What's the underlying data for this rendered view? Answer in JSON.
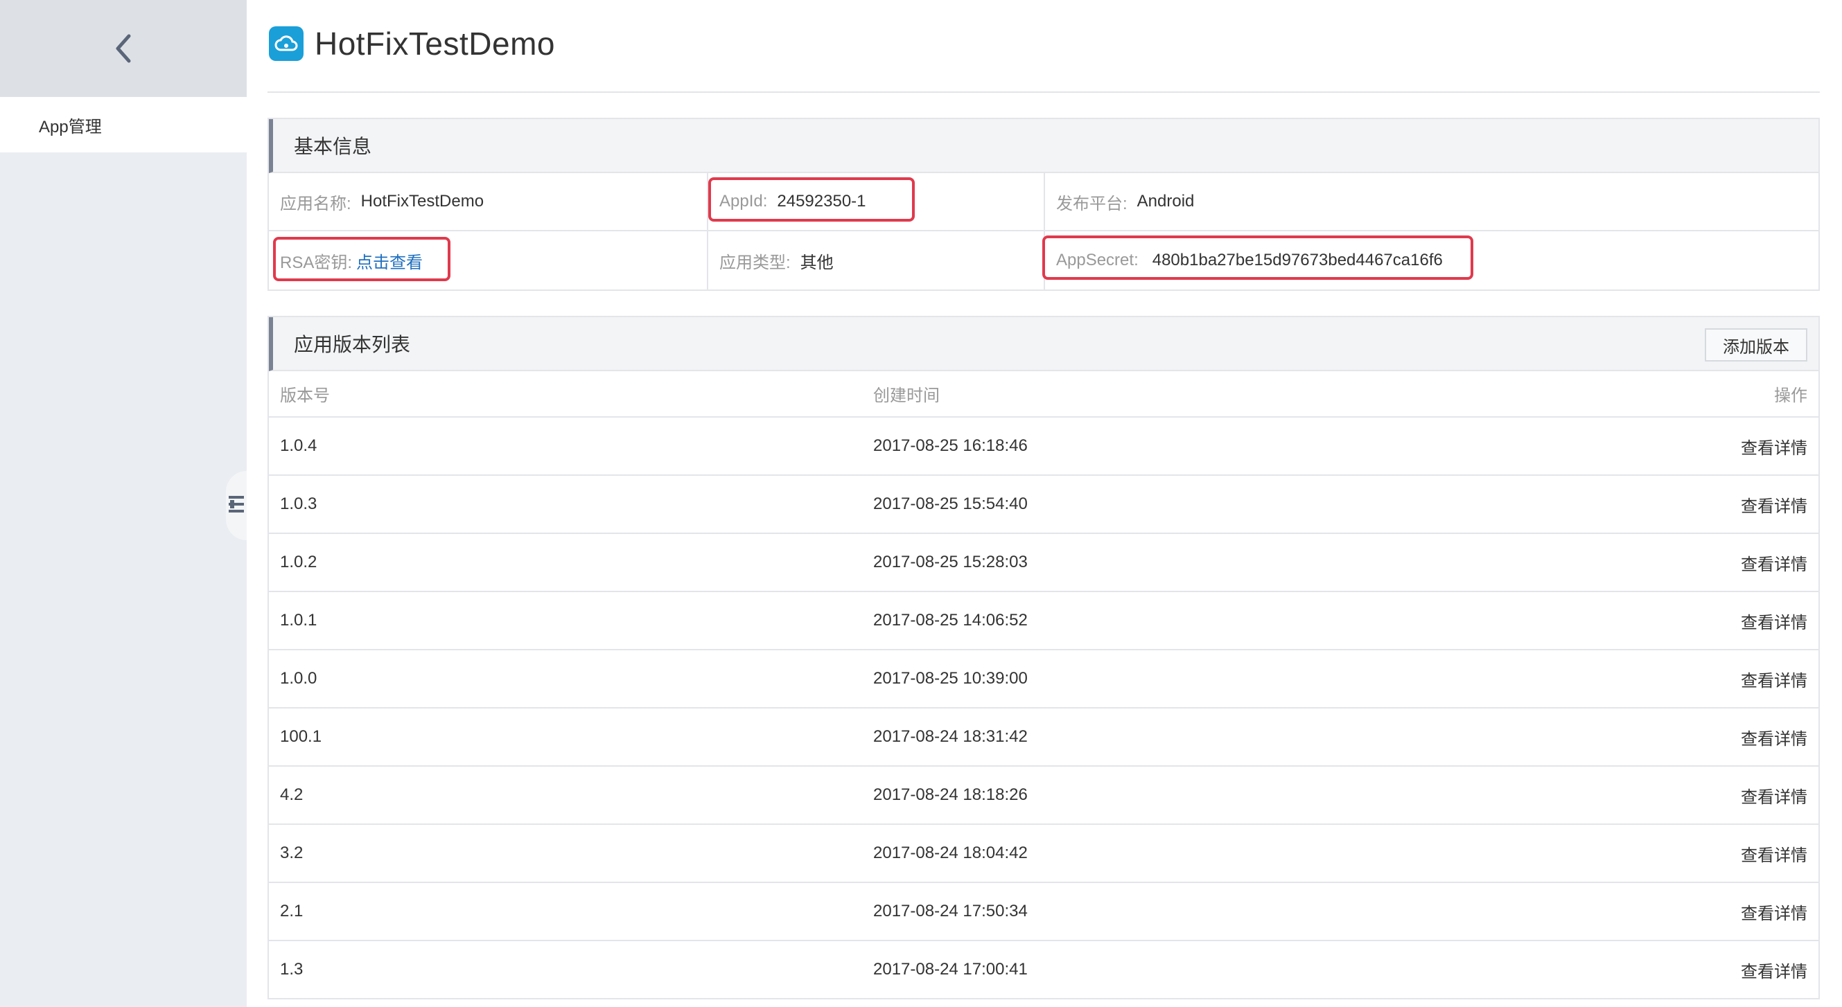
{
  "sidebar": {
    "back_icon": "chevron-left-icon",
    "items": [
      {
        "label": "App管理"
      }
    ]
  },
  "header": {
    "title": "HotFixTestDemo",
    "logo_icon": "cloud-app-icon"
  },
  "basic_info": {
    "heading": "基本信息",
    "app_name_label": "应用名称:",
    "app_name": "HotFixTestDemo",
    "appid_label": "AppId:",
    "appid": "24592350-1",
    "platform_label": "发布平台:",
    "platform": "Android",
    "rsa_label": "RSA密钥:",
    "rsa_link": "点击查看",
    "type_label": "应用类型:",
    "type": "其他",
    "secret_label": "AppSecret:",
    "secret": "480b1ba27be15d97673bed4467ca16f6"
  },
  "versions": {
    "heading": "应用版本列表",
    "add_button": "添加版本",
    "columns": [
      "版本号",
      "创建时间",
      "操作"
    ],
    "rows": [
      {
        "version": "1.0.4",
        "created": "2017-08-25 16:18:46",
        "action": "查看详情"
      },
      {
        "version": "1.0.3",
        "created": "2017-08-25 15:54:40",
        "action": "查看详情"
      },
      {
        "version": "1.0.2",
        "created": "2017-08-25 15:28:03",
        "action": "查看详情"
      },
      {
        "version": "1.0.1",
        "created": "2017-08-25 14:06:52",
        "action": "查看详情"
      },
      {
        "version": "1.0.0",
        "created": "2017-08-25 10:39:00",
        "action": "查看详情"
      },
      {
        "version": "100.1",
        "created": "2017-08-24 18:31:42",
        "action": "查看详情"
      },
      {
        "version": "4.2",
        "created": "2017-08-24 18:18:26",
        "action": "查看详情"
      },
      {
        "version": "3.2",
        "created": "2017-08-24 18:04:42",
        "action": "查看详情"
      },
      {
        "version": "2.1",
        "created": "2017-08-24 17:50:34",
        "action": "查看详情"
      },
      {
        "version": "1.3",
        "created": "2017-08-24 17:00:41",
        "action": "查看详情"
      }
    ]
  },
  "colors": {
    "accent_link": "#1f6fc0",
    "highlight": "#e03a4d",
    "logo": "#1a9fd9"
  }
}
